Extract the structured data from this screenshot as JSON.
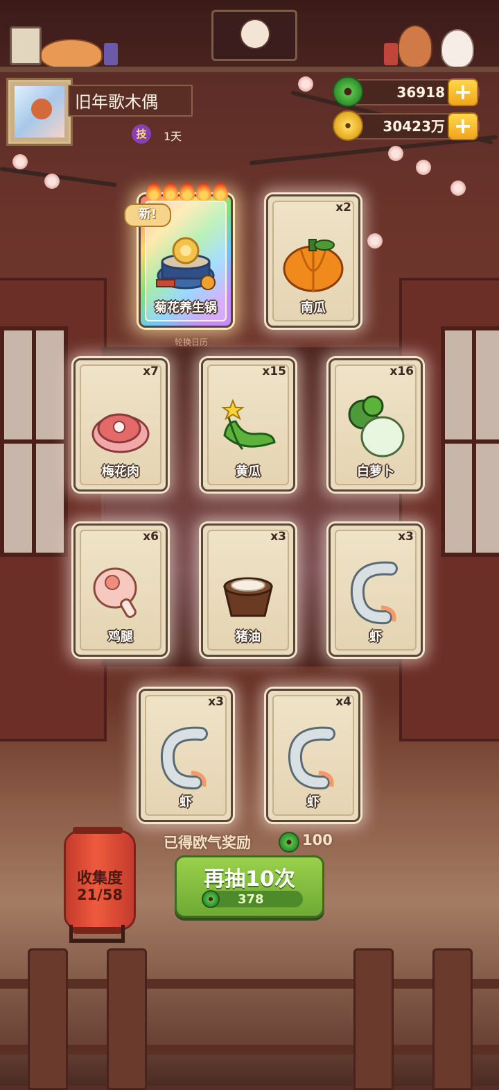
{
  "player": {
    "name": "旧年歌木偶",
    "skill_badge": "技",
    "days": "1天"
  },
  "currency": {
    "jade": "36918",
    "coins": "30423万"
  },
  "background": {
    "calendar_label": "轮换日历"
  },
  "cards": [
    {
      "name": "菊花养生锅",
      "count": "",
      "new_tag": "新!",
      "rarity_flames": 5,
      "icon": "chrysanthemum-hotpot-icon"
    },
    {
      "name": "南瓜",
      "count": "x2",
      "icon": "pumpkin-icon"
    },
    {
      "name": "梅花肉",
      "count": "x7",
      "icon": "pork-icon"
    },
    {
      "name": "黄瓜",
      "count": "x15",
      "icon": "cucumber-icon"
    },
    {
      "name": "白萝卜",
      "count": "x16",
      "icon": "radish-icon"
    },
    {
      "name": "鸡腿",
      "count": "x6",
      "icon": "chicken-leg-icon"
    },
    {
      "name": "猪油",
      "count": "x3",
      "icon": "lard-icon"
    },
    {
      "name": "虾",
      "count": "x3",
      "icon": "shrimp-icon"
    },
    {
      "name": "虾",
      "count": "x3",
      "icon": "shrimp-icon"
    },
    {
      "name": "虾",
      "count": "x4",
      "icon": "shrimp-icon"
    }
  ],
  "reward": {
    "label": "已得欧气奖励",
    "value": "100"
  },
  "collection": {
    "label": "收集度",
    "progress": "21/58"
  },
  "draw_button": {
    "label": "再抽10次",
    "cost": "378"
  }
}
